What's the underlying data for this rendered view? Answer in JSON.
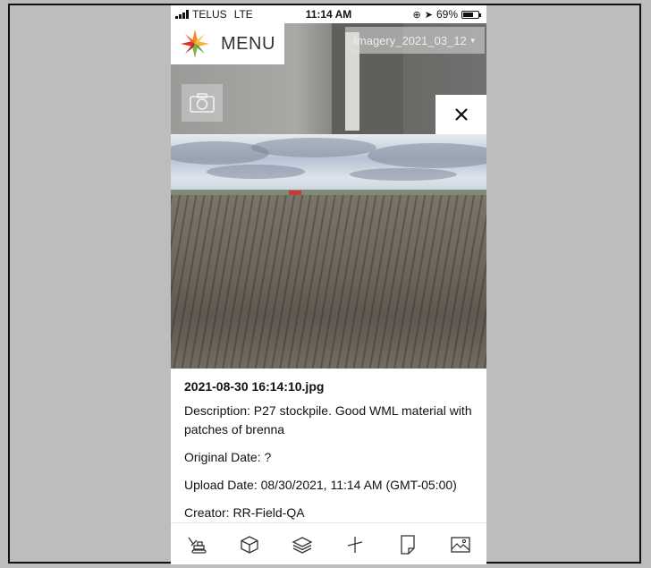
{
  "status_bar": {
    "carrier": "TELUS",
    "network": "LTE",
    "time": "11:14 AM",
    "battery": "69%",
    "battery_level": 0.69
  },
  "header": {
    "menu_label": "MENU",
    "imagery_select": "Imagery_2021_03_12"
  },
  "photo_details": {
    "filename": "2021-08-30 16:14:10.jpg",
    "description": "Description: P27 stockpile. Good WML material with patches of brenna",
    "original_date": "Original Date: ?",
    "upload_date": "Upload Date: 08/30/2021, 11:14 AM (GMT-05:00)",
    "creator": "Creator: RR-Field-QA"
  },
  "icons": {
    "camera": "camera-icon",
    "close": "close-icon",
    "toolbar": [
      "excavator-icon",
      "cube-icon",
      "layers-icon",
      "measure-icon",
      "note-icon",
      "image-icon"
    ]
  },
  "colors": {
    "background": "#bdbdbd",
    "panel": "#ffffff",
    "text": "#111111",
    "logo_orange": "#f28a1e",
    "logo_green": "#7ab648",
    "logo_red": "#d9342b"
  }
}
